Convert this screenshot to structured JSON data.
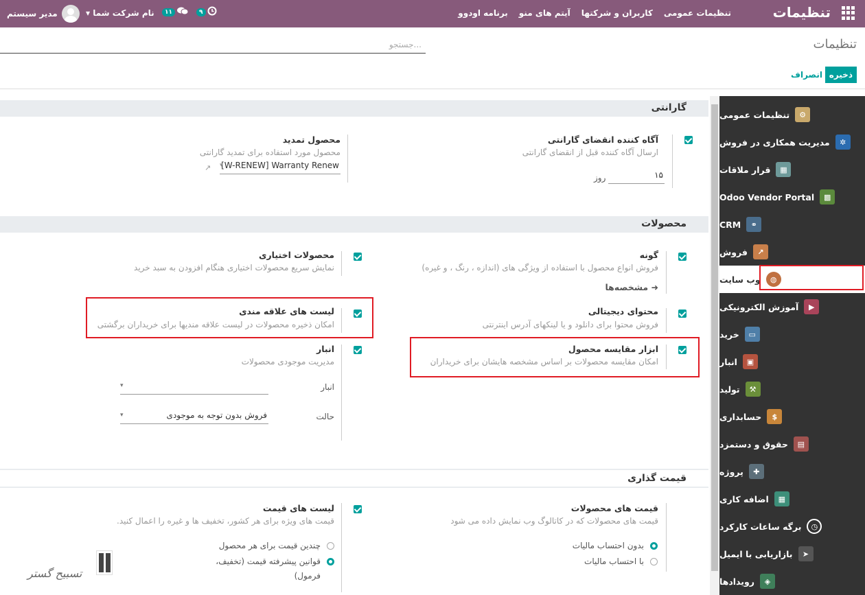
{
  "topbar": {
    "brand": "تنظیمات",
    "menu": [
      "تنظیمات عمومی",
      "کاربران و شرکتها",
      "آیتم های منو",
      "برنامه اودوو"
    ],
    "user": "مدیر سیستم",
    "company": "نام شرکت شما",
    "chat_count": "۱۱",
    "activity_count": "۹"
  },
  "control": {
    "title": "تنظیمات",
    "search_placeholder": "جستجو...",
    "save": "ذخیره",
    "discard": "انصراف"
  },
  "sidebar": [
    "تنظیمات عمومی",
    "مدیریت همکاری در فروش",
    "قرار ملاقات",
    "Odoo Vendor Portal",
    "CRM",
    "فروش",
    "وب سایت",
    "آموزش الکترونیکی",
    "خرید",
    "انبار",
    "تولید",
    "حسابداری",
    "حقوق و دستمزد",
    "پروژه",
    "اضافه کاری",
    "برگه ساعات کارکرد",
    "بازاریابی با ایمیل",
    "رویدادها"
  ],
  "sections": {
    "warranty": {
      "title": "گارانتی",
      "notifier": {
        "label": "آگاه کننده انقضای گارانتی",
        "desc": "ارسال آگاه کننده قبل از انقضای گارانتی",
        "days_value": "۱۵",
        "days_unit": "روز"
      },
      "renew": {
        "label": "محصول تمدید",
        "desc": "محصول مورد استفاده برای تمدید گارانتی",
        "value": "[W-RENEW] Warranty Renew"
      }
    },
    "products": {
      "title": "محصولات",
      "variants": {
        "label": "گونه",
        "desc": "فروش انواع محصول با استفاده از ویژگی های (اندازه ، رنگ ، و غیره)",
        "link": "مشخصه‌ها"
      },
      "optional": {
        "label": "محصولات اختیاری",
        "desc": "نمایش سریع محصولات اختیاری هنگام افزودن به سبد خرید"
      },
      "digital": {
        "label": "محتوای دیجیتالی",
        "desc": "فروش محتوا برای دانلود و یا لینکهای آدرس اینترنتی"
      },
      "wishlist": {
        "label": "لیست های علاقه مندی",
        "desc": "امکان ذخیره محصولات در لیست علاقه مندیها برای خریداران برگشتی"
      },
      "compare": {
        "label": "ابزار مقایسه محصول",
        "desc": "امکان مقایسه محصولات بر اساس مشخصه هایشان برای خریداران"
      },
      "inventory": {
        "label": "انبار",
        "desc": "مدیریت موجودی محصولات",
        "warehouse_label": "انبار",
        "warehouse_value": "",
        "mode_label": "حالت",
        "mode_value": "فروش بدون توجه به موجودی"
      }
    },
    "pricing": {
      "title": "قیمت گذاری",
      "product_prices": {
        "label": "قیمت های محصولات",
        "desc": "قیمت های محصولات که در کاتالوگ وب نمایش داده می شود",
        "opt1": "بدون احتساب مالیات",
        "opt2": "با احتساب مالیات"
      },
      "pricelists": {
        "label": "لیست های قیمت",
        "desc": "قیمت های ویژه برای هر کشور، تخفیف ها و غیره را اعمال کنید.",
        "opt1": "چندین قیمت برای هر محصول",
        "opt2": "قوانین پیشرفته قیمت (تخفیف،",
        "opt2b": "فرمول)"
      }
    }
  },
  "watermark": "تسبیح گستر"
}
